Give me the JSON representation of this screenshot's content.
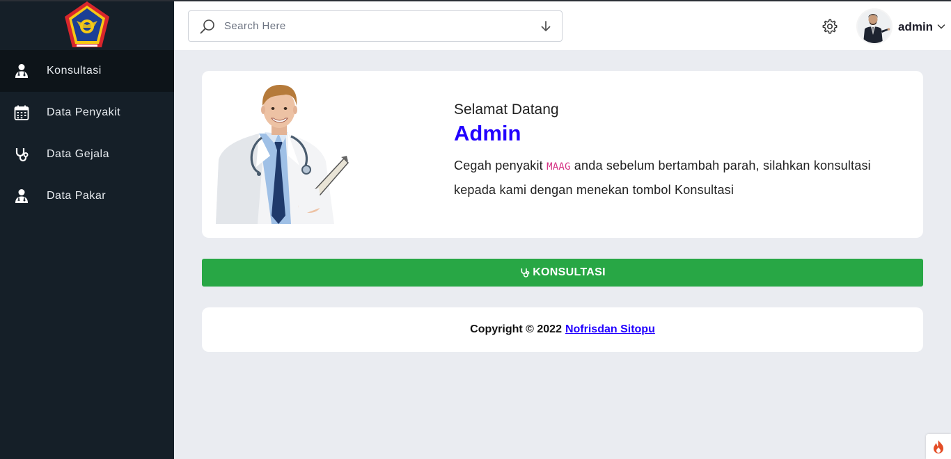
{
  "sidebar": {
    "items": [
      {
        "label": "Konsultasi",
        "icon": "user-doctor-icon",
        "active": true
      },
      {
        "label": "Data Penyakit",
        "icon": "calendar-icon",
        "active": false
      },
      {
        "label": "Data Gejala",
        "icon": "stethoscope-icon",
        "active": false
      },
      {
        "label": "Data Pakar",
        "icon": "user-doctor-icon",
        "active": false
      }
    ]
  },
  "header": {
    "search_placeholder": "Search Here",
    "user_name": "admin"
  },
  "welcome": {
    "greeting": "Selamat Datang",
    "title": "Admin",
    "desc_before": "Cegah penyakit ",
    "desc_code": "MAAG",
    "desc_after": " anda sebelum bertambah parah, silahkan konsultasi kepada kami dengan menekan tombol Konsultasi"
  },
  "action": {
    "button_label": "KONSULTASI"
  },
  "footer": {
    "copyright": "Copyright © 2022",
    "author": "Nofrisdan Sitopu"
  },
  "colors": {
    "sidebar_bg": "#151f28",
    "accent": "#2200ff",
    "button": "#28a745",
    "code": "#d63384"
  }
}
